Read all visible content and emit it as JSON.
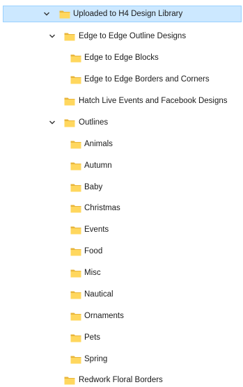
{
  "tree": {
    "root": {
      "label": "Uploaded to H4 Design Library",
      "expanded": true,
      "selected": true
    },
    "edge_to_edge": {
      "label": "Edge to Edge Outline Designs",
      "expanded": true
    },
    "edge_blocks": {
      "label": "Edge to Edge Blocks"
    },
    "edge_borders": {
      "label": "Edge to Edge Borders and Corners"
    },
    "hatch_live": {
      "label": "Hatch Live Events and Facebook Designs"
    },
    "outlines": {
      "label": "Outlines",
      "expanded": true
    },
    "outline_children": [
      {
        "label": "Animals"
      },
      {
        "label": "Autumn"
      },
      {
        "label": "Baby"
      },
      {
        "label": "Christmas"
      },
      {
        "label": "Events"
      },
      {
        "label": "Food"
      },
      {
        "label": "Misc"
      },
      {
        "label": "Nautical"
      },
      {
        "label": "Ornaments"
      },
      {
        "label": "Pets"
      },
      {
        "label": "Spring"
      }
    ],
    "redwork": {
      "label": "Redwork Floral Borders"
    }
  },
  "colors": {
    "selection_bg": "#cce8ff",
    "selection_border": "#99d1ff",
    "folder_front": "#ffd75e",
    "folder_back": "#e8b53a"
  },
  "icons": {
    "expand": "chevron-down-icon",
    "folder": "folder-icon"
  }
}
